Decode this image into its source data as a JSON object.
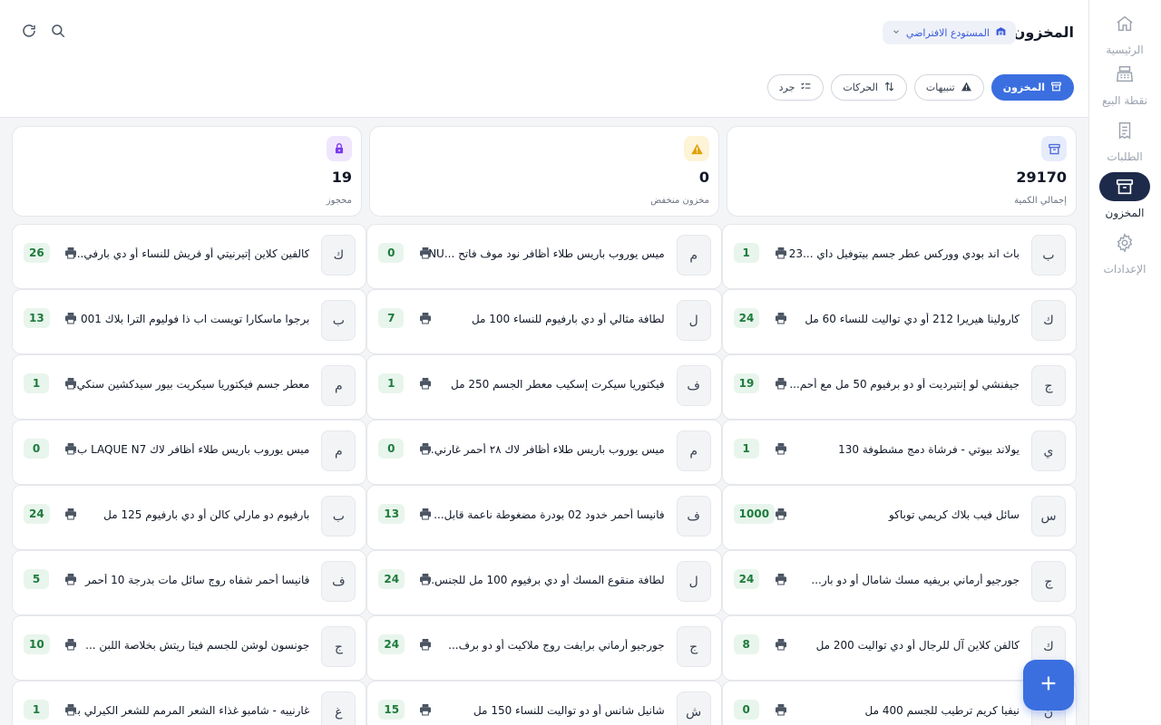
{
  "sidebar": {
    "items": [
      {
        "label": "الرئيسية",
        "icon": "home-icon"
      },
      {
        "label": "نقطة البيع",
        "icon": "cash-register-icon"
      },
      {
        "label": "الطلبات",
        "icon": "receipt-icon"
      },
      {
        "label": "المخزون",
        "icon": "archive-box-icon",
        "active": true
      },
      {
        "label": "الإعدادات",
        "icon": "gear-icon"
      }
    ]
  },
  "header": {
    "title": "المخزون",
    "store_select": "المستودع الافتراضي",
    "tabs": [
      {
        "label": "المخزون",
        "active": true
      },
      {
        "label": "تنبيهات"
      },
      {
        "label": "الحركات"
      },
      {
        "label": "جرد"
      }
    ]
  },
  "stats": [
    {
      "value": "29170",
      "label": "إجمالي الكمية",
      "icon": "archive-box-icon",
      "color": "#4f6bdc",
      "bg": "#e7ecfb"
    },
    {
      "value": "0",
      "label": "مخزون منخفض",
      "icon": "warning-icon",
      "color": "#e0a106",
      "bg": "#fdf3d7"
    },
    {
      "value": "19",
      "label": "محجوز",
      "icon": "lock-icon",
      "color": "#7c3aed",
      "bg": "#efe6fd"
    }
  ],
  "products": [
    {
      "initial": "ب",
      "name": "باث اند بودي ووركس عطر جسم بيتوفيل داي ...23",
      "qty": "1"
    },
    {
      "initial": "م",
      "name": "ميس يوروب باريس طلاء أظافر نود موف فاتح ...NU",
      "qty": "0"
    },
    {
      "initial": "ك",
      "name": "كالفين كلاين إتيرنيتي أو فريش للنساء أو دي بارفي...",
      "qty": "26"
    },
    {
      "initial": "ك",
      "name": "كارولينا هيريرا 212 أو دي تواليت للنساء 60 مل",
      "qty": "24"
    },
    {
      "initial": "ل",
      "name": "لطافة مثالي أو دي بارفيوم للنساء 100 مل",
      "qty": "7"
    },
    {
      "initial": "ب",
      "name": "برجوا ماسكارا تويست اب ذا فوليوم الترا بلاك 001",
      "qty": "13"
    },
    {
      "initial": "ج",
      "name": "جيفنشي لو إنتيرديت أو دو برفيوم 50 مل مع أحم...",
      "qty": "19"
    },
    {
      "initial": "ف",
      "name": "فيكتوريا سيكرت إسكيب معطر الجسم 250 مل",
      "qty": "1"
    },
    {
      "initial": "م",
      "name": "معطر جسم فيكتوريا سيكريت بيور سيدكشين سنكي...",
      "qty": "1"
    },
    {
      "initial": "ي",
      "name": "يولاند بيوتي - فرشاة دمج مشطوفة 130",
      "qty": "1"
    },
    {
      "initial": "م",
      "name": "ميس يوروب باريس طلاء أظافر لاك ٢٨ أحمر غارني...",
      "qty": "0"
    },
    {
      "initial": "م",
      "name": "ميس يوروب باريس طلاء أظافر لاك LAQUE N7 ب...",
      "qty": "0"
    },
    {
      "initial": "س",
      "name": "سائل فيب بلاك كريمي توباكو",
      "qty": "1000"
    },
    {
      "initial": "ف",
      "name": "فانيسا أحمر خدود 02 بودرة مضغوطة ناعمة قابل...",
      "qty": "13"
    },
    {
      "initial": "ب",
      "name": "بارفيوم دو مارلي كالن أو دي بارفيوم 125 مل",
      "qty": "24"
    },
    {
      "initial": "ج",
      "name": "جورجيو أرماني بريفيه مسك شامال أو دو بار...",
      "qty": "24"
    },
    {
      "initial": "ل",
      "name": "لطافة منقوع المسك أو دي برفيوم 100 مل للجنس...",
      "qty": "24"
    },
    {
      "initial": "ف",
      "name": "فانيسا أحمر شفاه روج سائل مات بدرجة 10 أحمر",
      "qty": "5"
    },
    {
      "initial": "ك",
      "name": "كالفن كلاين آل للرجال أو دي تواليت 200 مل",
      "qty": "8"
    },
    {
      "initial": "ج",
      "name": "جورجيو أرماني برايفت روج ملاكيت أو دو برف...",
      "qty": "24"
    },
    {
      "initial": "ج",
      "name": "جونسون لوشن للجسم فيتا ريتش بخلاصة اللبن ...",
      "qty": "10"
    },
    {
      "initial": "ن",
      "name": "نيفيا كريم ترطيب للجسم 400 مل",
      "qty": "0"
    },
    {
      "initial": "ش",
      "name": "شانيل شانس أو دو تواليت للنساء 150 مل",
      "qty": "15"
    },
    {
      "initial": "غ",
      "name": "غارنييه - شامبو غذاء الشعر المرمم للشعر الكيرلي بز...",
      "qty": "1"
    }
  ]
}
